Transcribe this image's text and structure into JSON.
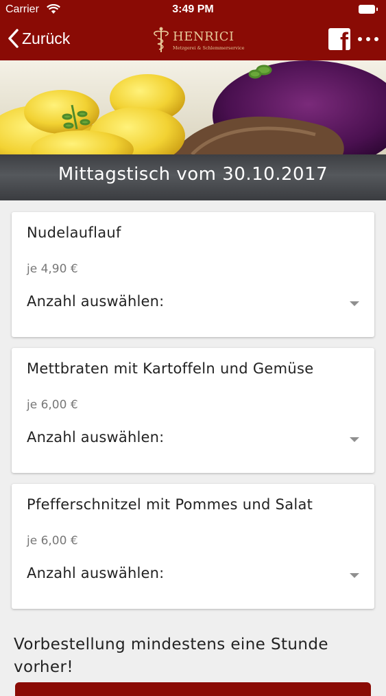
{
  "status_bar": {
    "carrier": "Carrier",
    "time": "3:49 PM"
  },
  "nav": {
    "back_label": "Zurück",
    "logo_name": "HENRICI",
    "logo_tagline": "Metzgerei & Schlemmerservice",
    "share_icon": "facebook-icon",
    "more_icon": "more-icon"
  },
  "banner": {
    "title": "Mittagstisch vom 30.10.2017"
  },
  "menu": {
    "items": [
      {
        "name": "Nudelauflauf",
        "price": "je 4,90 €",
        "select_placeholder": "Anzahl auswählen:"
      },
      {
        "name": "Mettbraten mit Kartoffeln und Gemüse",
        "price": "je 6,00 €",
        "select_placeholder": "Anzahl auswählen:"
      },
      {
        "name": "Pfefferschnitzel mit Pommes und Salat",
        "price": "je 6,00 €",
        "select_placeholder": "Anzahl auswählen:"
      }
    ]
  },
  "footer": {
    "notice": "Vorbestellung mindestens eine Stunde vorher!"
  },
  "colors": {
    "brand": "#8a0b05",
    "logo_gold": "#e7c99a",
    "background": "#efefef"
  }
}
